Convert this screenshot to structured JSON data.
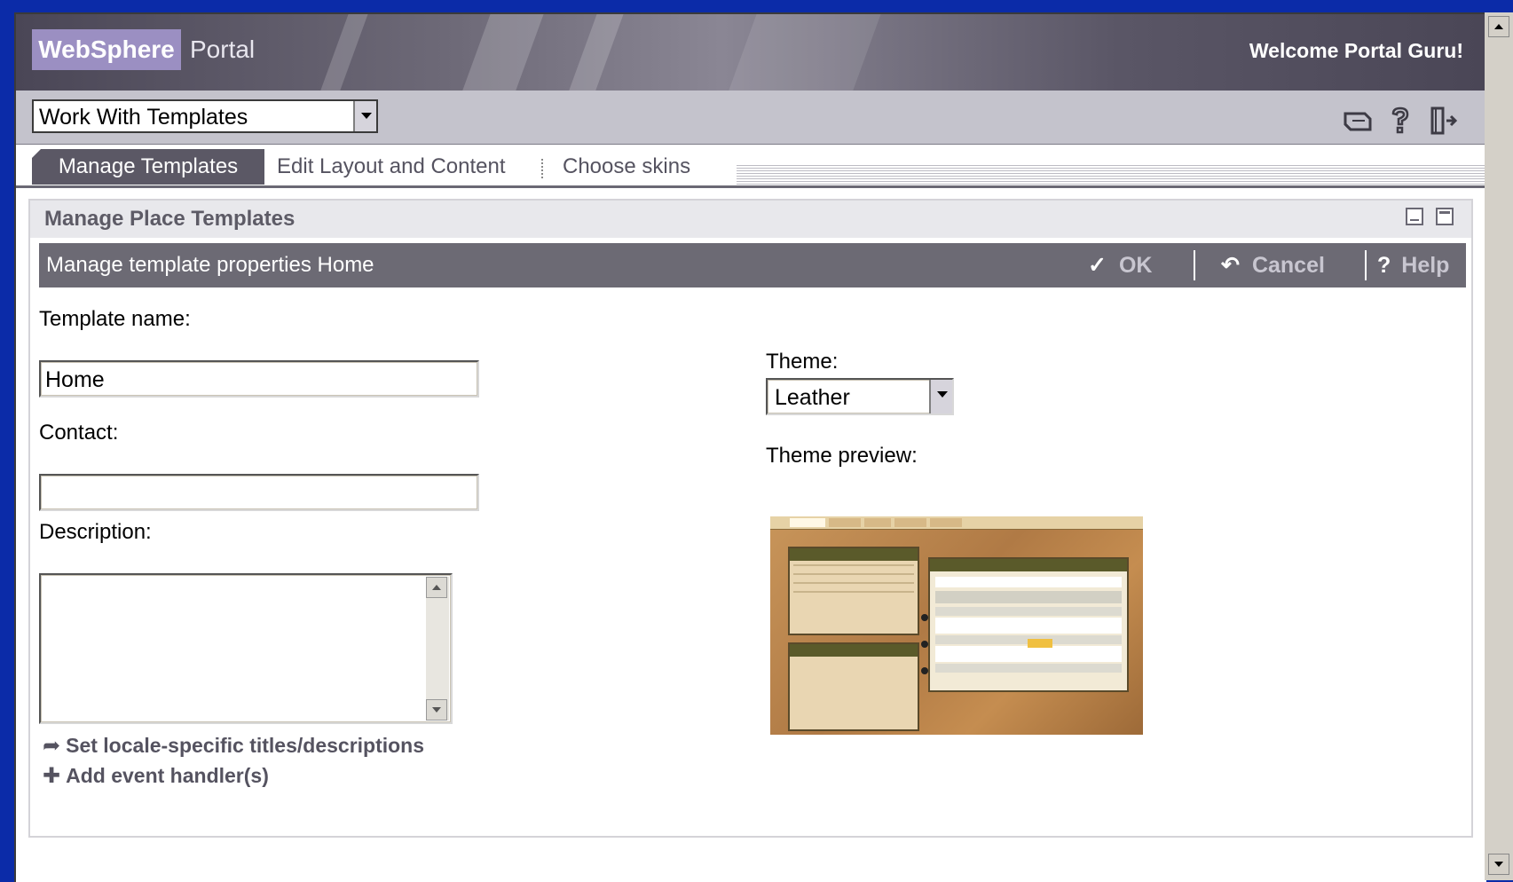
{
  "banner": {
    "brand": "WebSphere",
    "product": "Portal",
    "welcome": "Welcome Portal Guru!"
  },
  "nav": {
    "selected_page": "Work With Templates",
    "icons": [
      "edit-profile-icon",
      "help-icon",
      "logout-icon"
    ]
  },
  "tabs": [
    {
      "label": "Manage Templates",
      "active": true
    },
    {
      "label": "Edit Layout and Content",
      "active": false
    },
    {
      "label": "Choose skins",
      "active": false
    }
  ],
  "portlet": {
    "title": "Manage Place Templates",
    "action_title": "Manage template properties  Home",
    "ok_label": "OK",
    "cancel_label": "Cancel",
    "help_label": "Help"
  },
  "form": {
    "template_name_label": "Template name:",
    "template_name_value": "Home",
    "contact_label": "Contact:",
    "contact_value": "",
    "description_label": "Description:",
    "description_value": "",
    "locale_link": "Set locale-specific titles/descriptions",
    "event_link": "Add event handler(s)",
    "theme_label": "Theme:",
    "theme_value": "Leather",
    "theme_preview_label": "Theme preview:"
  },
  "colors": {
    "desktop": "#0b2ba8",
    "banner": "#4a4656",
    "brand_box": "#9b8fc2",
    "tab_active": "#5b5865",
    "action_bar": "#6c6a74",
    "preview_leather": "#b07a45"
  }
}
